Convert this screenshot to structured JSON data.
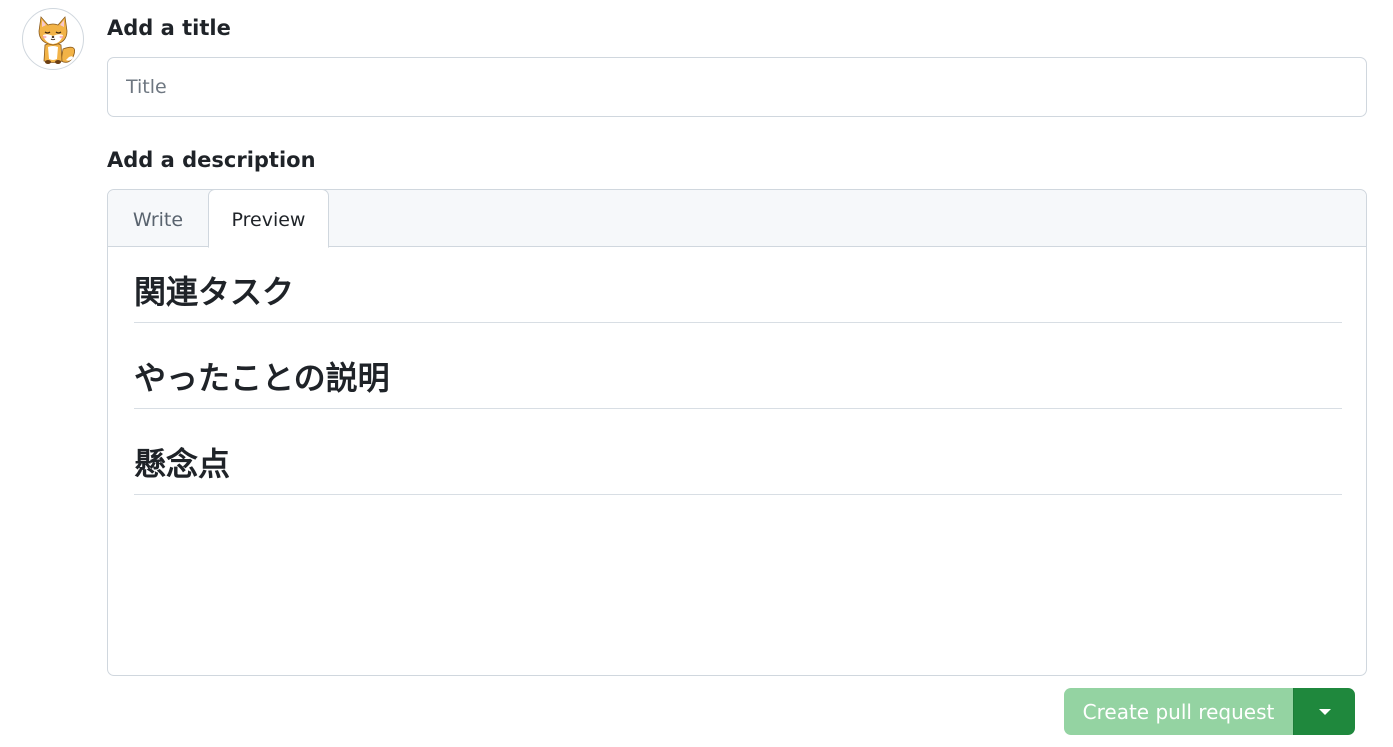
{
  "avatar": {
    "icon": "fox-avatar-icon"
  },
  "title_section": {
    "label": "Add a title",
    "input_placeholder": "Title",
    "input_value": ""
  },
  "description_section": {
    "label": "Add a description",
    "tabs": [
      {
        "label": "Write",
        "active": false
      },
      {
        "label": "Preview",
        "active": true
      }
    ],
    "preview_headings": [
      "関連タスク",
      "やったことの説明",
      "懸念点"
    ]
  },
  "actions": {
    "create_label": "Create pull request",
    "create_enabled": false,
    "dropdown_icon": "triangle-down-icon"
  },
  "colors": {
    "primary_green": "#1f883d",
    "disabled_green": "#94d3a2",
    "border": "#d0d7de",
    "text": "#1f2328",
    "muted_text": "#59636e",
    "tab_bar_bg": "#f6f8fa"
  }
}
